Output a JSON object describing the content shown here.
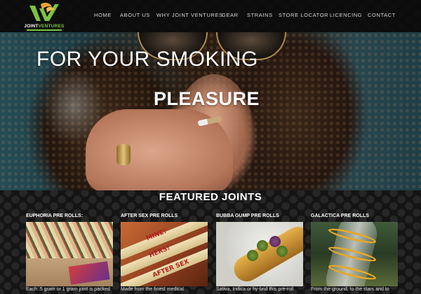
{
  "header": {
    "logo": {
      "name_part1": "JOINT",
      "name_part2": "VENTURES",
      "accent_color": "#7cc341"
    },
    "nav": [
      {
        "label": "HOME"
      },
      {
        "label": "ABOUT US"
      },
      {
        "label": "WHY JOINT VENTURES"
      },
      {
        "label": "GEAR"
      },
      {
        "label": "STRAINS"
      },
      {
        "label": "STORE LOCATOR"
      },
      {
        "label": "LICENCING"
      },
      {
        "label": "CONTACT"
      }
    ]
  },
  "hero": {
    "line1": "FOR YOUR SMOKING",
    "line2": "PLEASURE"
  },
  "featured": {
    "title": "FEATURED JOINTS",
    "cards": [
      {
        "title": "EUPHORIA PRE ROLLS:",
        "description": "Each .5 gram or 1 gram joint is packed"
      },
      {
        "title": "AFTER SEX PRE ROLLS",
        "description": "Made from the finest medical"
      },
      {
        "title": "BUBBA GUMP PRE ROLLS",
        "description": "Sativa, Indica or hy-brid this pre-roll"
      },
      {
        "title": "GALACTICA PRE ROLLS",
        "description": "From the ground, to the stars and to"
      }
    ],
    "image_text": {
      "line1": "MINE!",
      "line2": "HERS!",
      "line3": "AFTER SEX"
    }
  }
}
